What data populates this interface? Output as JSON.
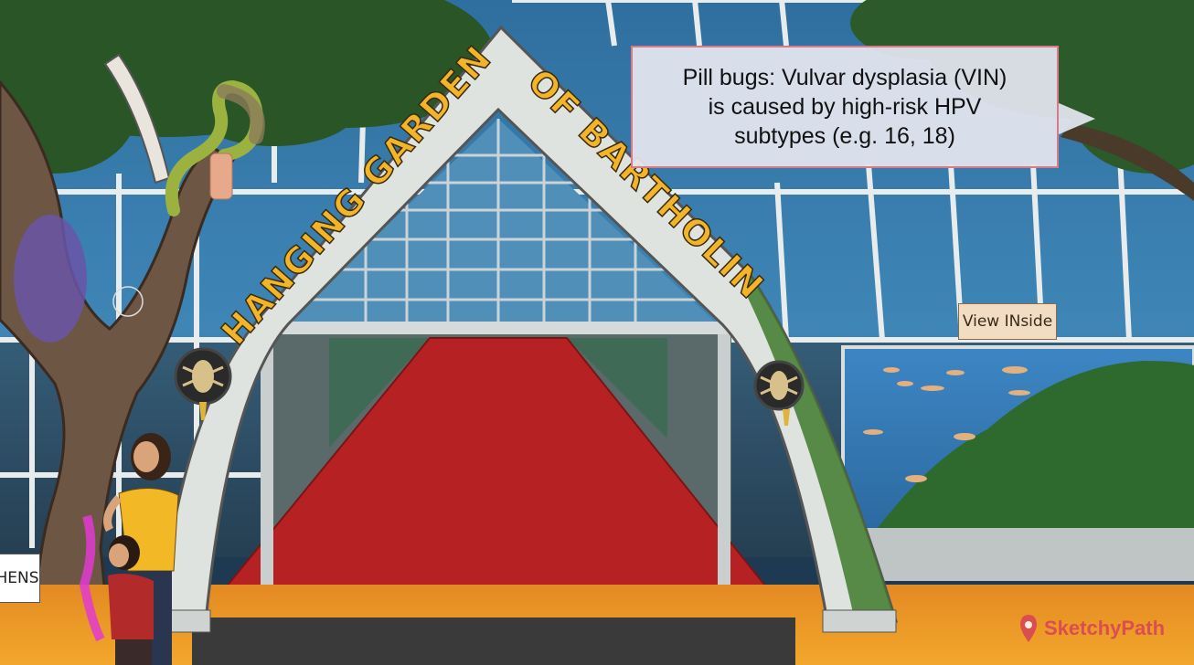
{
  "scene": {
    "arch_title_left": "HANGING GARDENS",
    "arch_title_right": "OF BARTHOLIN",
    "callout": {
      "line1": "Pill bugs: Vulvar dysplasia (VIN)",
      "line2": "is caused by high-risk HPV",
      "line3": "subtypes (e.g. 16, 18)"
    },
    "view_sign": "View INside",
    "side_sign": "HENS",
    "logo_text": "SketchyPath"
  },
  "colors": {
    "sky_glass": "#3f7fb0",
    "arch": "#dfe3e0",
    "lettering": "#f2b52a",
    "carpet": "#b62223",
    "foliage": "#2f5a26",
    "callout_border": "#d77a8a",
    "brand": "#d94158"
  },
  "icons": [
    "pill-bug-medallion-icon",
    "sketchy-logo-icon"
  ]
}
